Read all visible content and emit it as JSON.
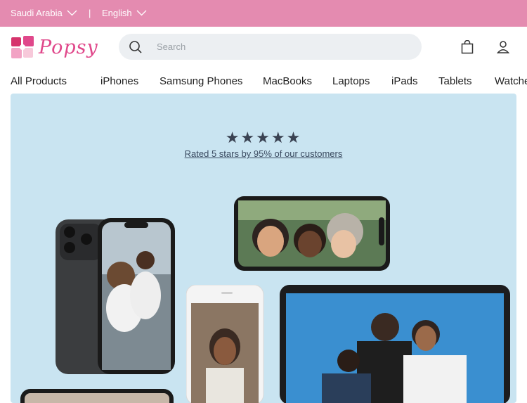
{
  "topbar": {
    "country": "Saudi Arabia",
    "separator": "|",
    "language": "English"
  },
  "brand": {
    "name": "Popsy",
    "color": "#e0488b",
    "topbar_color": "#e48bb0"
  },
  "search": {
    "placeholder": "Search"
  },
  "header_icons": [
    "bag-icon",
    "user-icon"
  ],
  "nav": {
    "items": [
      "All Products",
      "iPhones",
      "Samsung Phones",
      "MacBooks",
      "Laptops",
      "iPads",
      "Tablets",
      "Watches"
    ]
  },
  "hero": {
    "stars": "★★★★★",
    "rating_text": "Rated 5 stars by 95% of our customers",
    "background": "#c9e4f1"
  }
}
